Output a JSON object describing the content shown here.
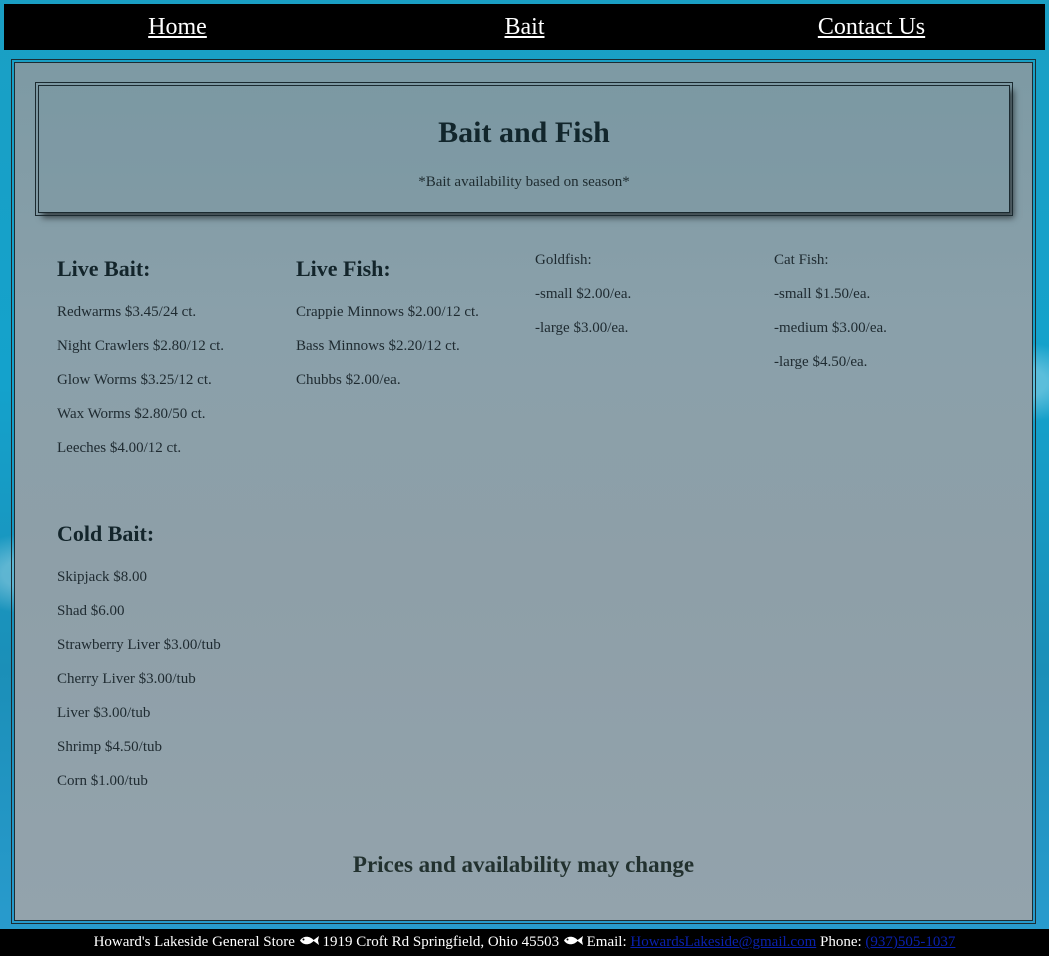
{
  "nav": {
    "home": "Home",
    "bait": "Bait",
    "contact": "Contact Us"
  },
  "header": {
    "title": "Bait and Fish",
    "subtitle": "*Bait availability based on season*"
  },
  "live_bait": {
    "heading": "Live Bait:",
    "items": [
      "Redwarms $3.45/24 ct.",
      "Night Crawlers $2.80/12 ct.",
      "Glow Worms $3.25/12 ct.",
      "Wax Worms $2.80/50 ct.",
      "Leeches $4.00/12 ct."
    ]
  },
  "live_fish": {
    "heading": "Live Fish:",
    "items": [
      "Crappie Minnows $2.00/12 ct.",
      "Bass Minnows $2.20/12 ct.",
      "Chubbs $2.00/ea."
    ]
  },
  "goldfish": {
    "items": [
      "Goldfish:",
      "-small $2.00/ea.",
      "-large $3.00/ea."
    ]
  },
  "catfish": {
    "items": [
      "Cat Fish:",
      "-small $1.50/ea.",
      "-medium $3.00/ea.",
      "-large $4.50/ea."
    ]
  },
  "cold_bait": {
    "heading": "Cold Bait:",
    "items": [
      "Skipjack $8.00",
      "Shad $6.00",
      "Strawberry Liver $3.00/tub",
      "Cherry Liver $3.00/tub",
      "Liver $3.00/tub",
      "Shrimp $4.50/tub",
      "Corn $1.00/tub"
    ]
  },
  "notice": "Prices and availability may change",
  "footer": {
    "store": "Howard's Lakeside General Store",
    "address": "1919 Croft Rd Springfield, Ohio 45503",
    "email_label": "Email:",
    "email": "HowardsLakeside@gmail.com",
    "phone_label": "Phone:",
    "phone": "(937)505-1037",
    "separator_icon": "fish-icon"
  },
  "colors": {
    "nav_bg": "#000000",
    "footer_link": "#0a21ad"
  }
}
